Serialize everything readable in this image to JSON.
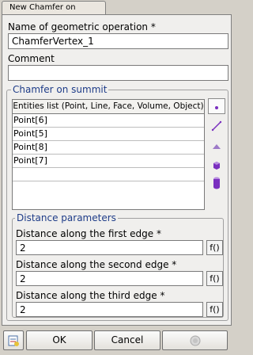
{
  "tab": {
    "label": "New Chamfer on summit"
  },
  "name_field": {
    "label": "Name of geometric operation *",
    "value": "ChamferVertex_1"
  },
  "comment_field": {
    "label": "Comment",
    "value": ""
  },
  "chamfer_group": {
    "legend": "Chamfer on summit",
    "table_header": "Entities list (Point, Line, Face, Volume, Object)",
    "rows": [
      "Point[6]",
      "Point[5]",
      "Point[8]",
      "Point[7]"
    ],
    "selection_tools": [
      "point-filter-icon",
      "line-filter-icon",
      "face-filter-icon",
      "volume-filter-icon",
      "object-filter-icon"
    ]
  },
  "distance_group": {
    "legend": "Distance parameters",
    "fields": [
      {
        "label": "Distance along the first edge *",
        "value": "2",
        "func_label": "f()"
      },
      {
        "label": "Distance along the second edge *",
        "value": "2",
        "func_label": "f()"
      },
      {
        "label": "Distance along the third edge *",
        "value": "2",
        "func_label": "f()"
      }
    ]
  },
  "buttons": {
    "ok": "OK",
    "cancel": "Cancel"
  },
  "colors": {
    "legend_text": "#1e3c88",
    "selection_accent": "#7a2fbf",
    "panel_bg": "#f0efed"
  }
}
